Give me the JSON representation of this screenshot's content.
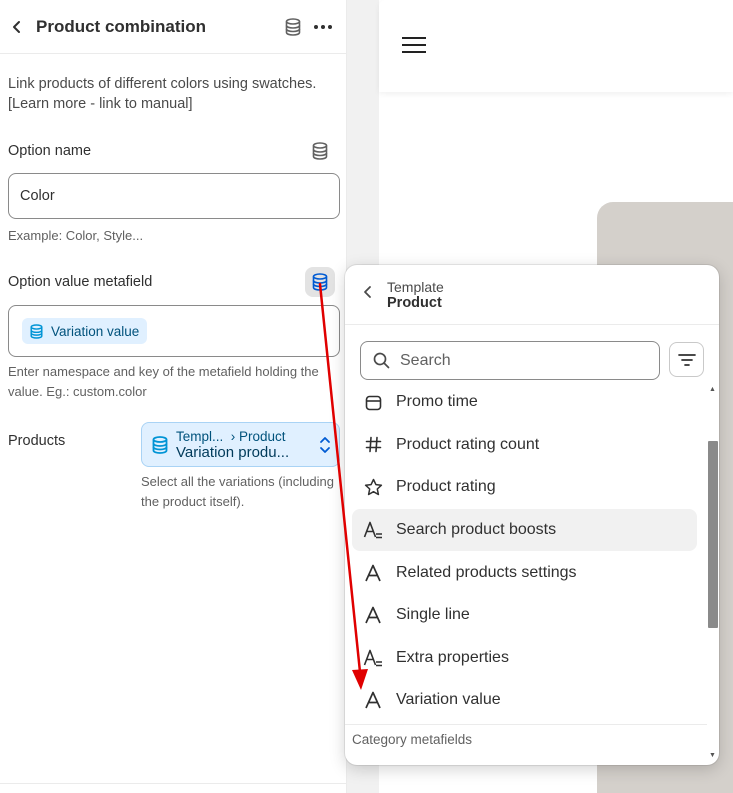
{
  "header": {
    "title": "Product combination"
  },
  "description": "Link products of different colors using swatches. [Learn more - link to manual]",
  "option_name": {
    "label": "Option name",
    "value": "Color",
    "hint": "Example: Color, Style..."
  },
  "option_value_metafield": {
    "label": "Option value metafield",
    "chip": "Variation value",
    "hint": "Enter namespace and key of the metafield holding the value. Eg.: custom.color"
  },
  "products": {
    "label": "Products",
    "path_source": "Templ...",
    "path_target": "Product",
    "value": "Variation produ...",
    "hint": "Select all the variations (including the product itself)."
  },
  "popover": {
    "breadcrumb": "Template",
    "title": "Product",
    "search_placeholder": "Search",
    "items": [
      {
        "label": "Promo time",
        "icon": "calendar-icon"
      },
      {
        "label": "Product rating count",
        "icon": "hash-icon"
      },
      {
        "label": "Product rating",
        "icon": "star-icon"
      },
      {
        "label": "Search product boosts",
        "icon": "multiline-text-icon"
      },
      {
        "label": "Related products settings",
        "icon": "text-icon"
      },
      {
        "label": "Single line",
        "icon": "text-icon"
      },
      {
        "label": "Extra properties",
        "icon": "multiline-text-icon"
      },
      {
        "label": "Variation value",
        "icon": "text-icon"
      }
    ],
    "section": "Category metafields"
  },
  "colors": {
    "accent_blue": "#005bd3",
    "chip_bg": "#e0f0ff",
    "annotation_arrow": "#e00000"
  }
}
